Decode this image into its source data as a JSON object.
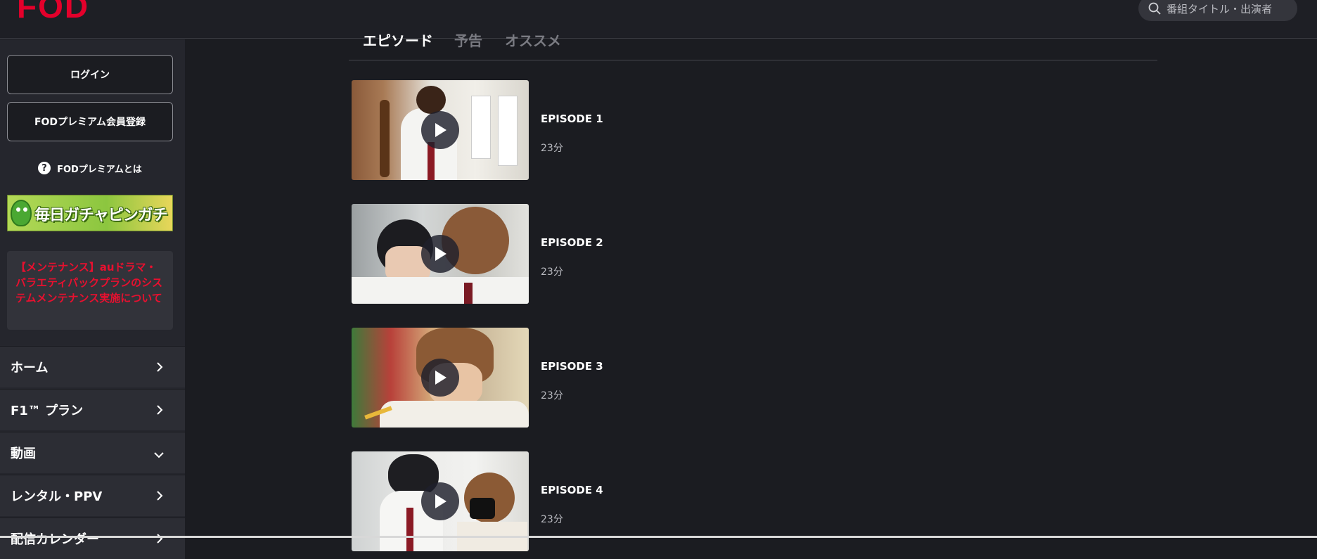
{
  "header": {
    "logo": "FOD",
    "search_placeholder": "番組タイトル・出演者"
  },
  "sidebar": {
    "login_label": "ログイン",
    "register_label": "FODプレミアム会員登録",
    "premium_about_label": "FODプレミアムとは",
    "banner_text": "毎日ガチャピンガチャ",
    "notice_text": "【メンテナンス】auドラマ・バラエティパックプランのシステムメンテナンス実施について",
    "nav": [
      {
        "label": "ホーム",
        "icon": "chevron-right-icon"
      },
      {
        "label": "F1™ プラン",
        "icon": "chevron-right-icon"
      },
      {
        "label": "動画",
        "icon": "chevron-down-icon"
      },
      {
        "label": "レンタル・PPV",
        "icon": "chevron-right-icon"
      },
      {
        "label": "配信カレンダー",
        "icon": "chevron-right-icon"
      }
    ]
  },
  "tabs": [
    {
      "label": "エピソード",
      "active": true
    },
    {
      "label": "予告",
      "active": false
    },
    {
      "label": "オススメ",
      "active": false
    }
  ],
  "episodes": [
    {
      "title": "EPISODE 1",
      "duration": "23分"
    },
    {
      "title": "EPISODE 2",
      "duration": "23分"
    },
    {
      "title": "EPISODE 3",
      "duration": "23分"
    },
    {
      "title": "EPISODE 4",
      "duration": "23分"
    }
  ],
  "colors": {
    "brand": "#e4002b",
    "background": "#1b1c21",
    "sidebar": "#25262d",
    "notice_text": "#e8102f"
  }
}
